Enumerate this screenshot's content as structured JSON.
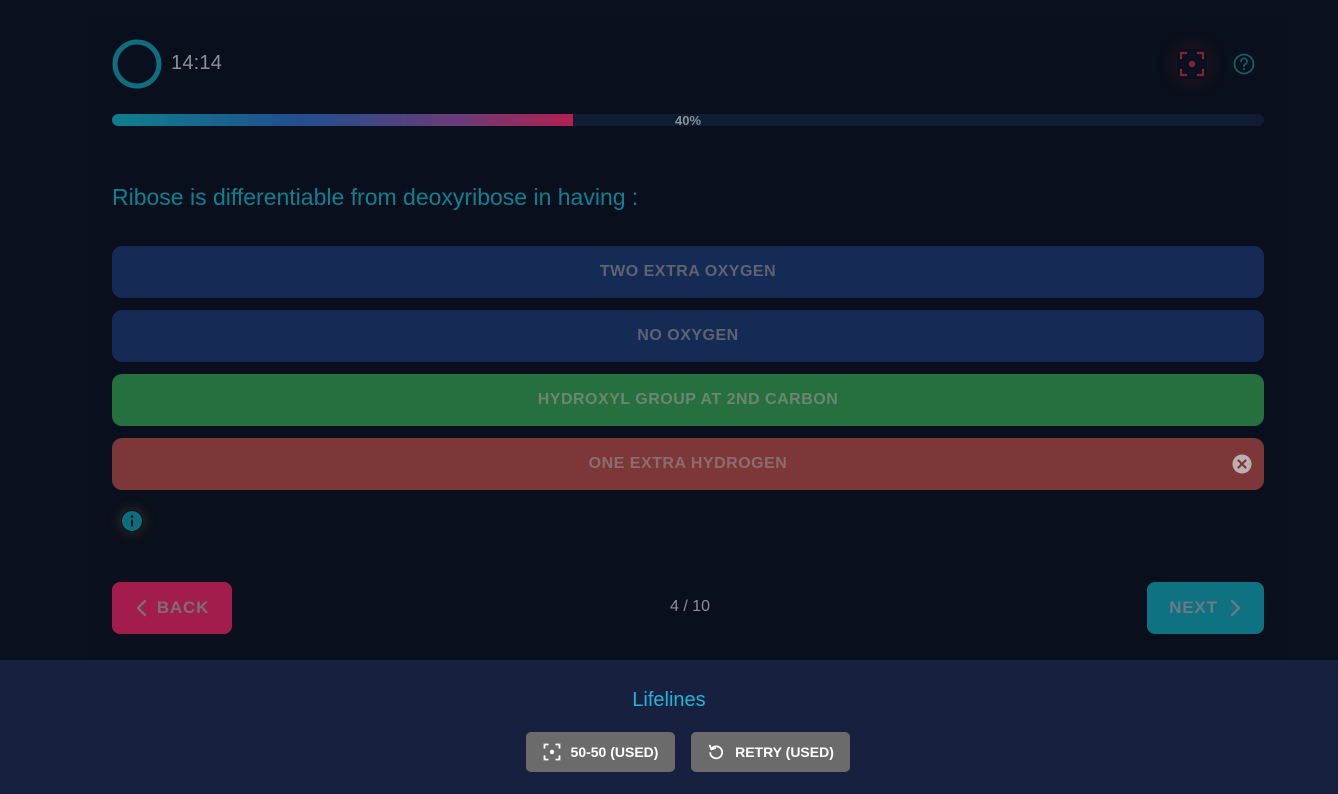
{
  "timer": {
    "value": "14:14",
    "ring_color": "#0f6e7e"
  },
  "header": {
    "focus_icon": "focus-target-icon",
    "help_icon": "question-circle-icon"
  },
  "progress": {
    "label": "40%",
    "fraction": 0.4
  },
  "question": {
    "text": "Ribose is differentiable from deoxyribose in having :",
    "options": [
      {
        "label": "TWO EXTRA OXYGEN",
        "state": "neutral"
      },
      {
        "label": "NO OXYGEN",
        "state": "neutral"
      },
      {
        "label": "HYDROXYL GROUP AT 2ND CARBON",
        "state": "correct"
      },
      {
        "label": "ONE EXTRA HYDROGEN",
        "state": "wrong"
      }
    ]
  },
  "nav": {
    "back_label": "BACK",
    "next_label": "NEXT",
    "counter": "4 / 10"
  },
  "lifelines": {
    "title": "Lifelines",
    "fifty_label": "50-50 (USED)",
    "retry_label": "RETRY (USED)"
  },
  "colors": {
    "accent_teal": "#0e7282",
    "accent_red": "#a31d4c",
    "correct": "#26703f",
    "wrong": "#7e3739",
    "lifeline_title": "#22b4d6"
  }
}
